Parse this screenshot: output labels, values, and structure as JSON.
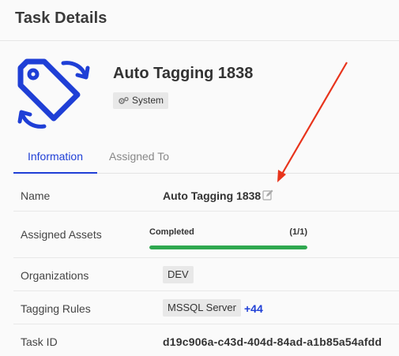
{
  "header": {
    "title": "Task Details"
  },
  "task": {
    "title": "Auto Tagging 1838",
    "badge_label": "System",
    "icon": "tag-sync-icon",
    "icon_color": "#1f3fd6"
  },
  "tabs": [
    {
      "label": "Information",
      "active": true
    },
    {
      "label": "Assigned To",
      "active": false
    }
  ],
  "details": {
    "name": {
      "label": "Name",
      "value": "Auto Tagging 1838"
    },
    "assigned_assets": {
      "label": "Assigned Assets",
      "status": "Completed",
      "count": "(1/1)",
      "progress_fraction": 1.0
    },
    "organizations": {
      "label": "Organizations",
      "value": "DEV"
    },
    "tagging_rules": {
      "label": "Tagging Rules",
      "value": "MSSQL Server",
      "more": "+44"
    },
    "task_id": {
      "label": "Task ID",
      "value": "d19c906a-c43d-404d-84ad-a1b85a54afdd"
    }
  },
  "colors": {
    "accent": "#1f3fd6",
    "progress": "#2ea84f",
    "annotation_arrow": "#e8341c"
  }
}
